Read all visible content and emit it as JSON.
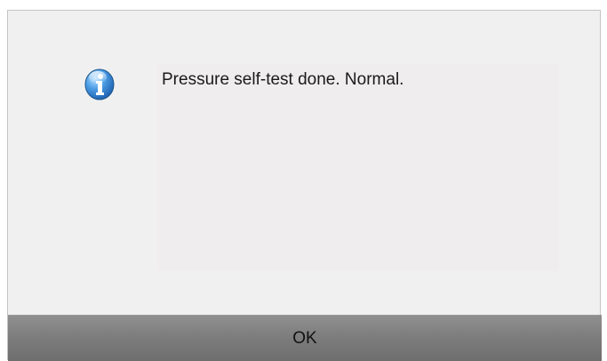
{
  "dialog": {
    "icon": "info-icon",
    "message": "Pressure self-test done. Normal.",
    "ok_label": "OK"
  },
  "colors": {
    "dialog_bg": "#f1f0f0",
    "button_bg": "#7c7c7c",
    "icon_blue": "#2f7fd0"
  }
}
